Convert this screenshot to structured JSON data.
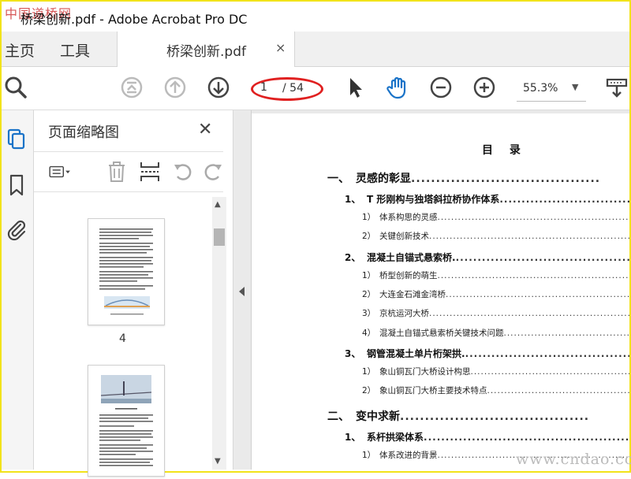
{
  "window": {
    "title": "桥梁创新.pdf - Adobe Acrobat Pro DC",
    "logo_text": "中国道桥网"
  },
  "menu": {
    "home": "主页",
    "tools": "工具"
  },
  "tab": {
    "name": "桥梁创新.pdf",
    "close": "×"
  },
  "toolbar": {
    "page_current": "1",
    "page_total": "/ 54",
    "zoom": "55.3%",
    "zoom_arrow": "▼"
  },
  "thumbnails": {
    "title": "页面缩略图",
    "close": "✕",
    "pages": [
      {
        "label": "4"
      }
    ]
  },
  "toc": {
    "title": "目 录",
    "rows": [
      {
        "level": 1,
        "num": "一、",
        "text": "灵感的彰显",
        "dots": "......................................"
      },
      {
        "level": 2,
        "num": "1、",
        "text": "T 形刚构与独塔斜拉桥协作体系",
        "dots": "............................................"
      },
      {
        "level": 3,
        "num": "1）",
        "text": "体系构思的灵感",
        "dots": "....................................................................................................."
      },
      {
        "level": 3,
        "num": "2）",
        "text": "关键创新技术",
        "dots": "....................................................................................................."
      },
      {
        "level": 2,
        "num": "2、",
        "text": "混凝土自锚式悬索桥.",
        "dots": "...................................................................."
      },
      {
        "level": 3,
        "num": "1）",
        "text": "桥型创新的萌生",
        "dots": "....................................................................................................."
      },
      {
        "level": 3,
        "num": "2）",
        "text": "大连金石滩金湾桥",
        "dots": "....................................................................................................."
      },
      {
        "level": 3,
        "num": "3）",
        "text": "京杭运河大桥",
        "dots": "....................................................................................................."
      },
      {
        "level": 3,
        "num": "4）",
        "text": "混凝土自锚式悬索桥关键技术问题",
        "dots": "....................................................................................................."
      },
      {
        "level": 2,
        "num": "3、",
        "text": "钢管混凝土单片桁架拱.",
        "dots": "..............................................................."
      },
      {
        "level": 3,
        "num": "1）",
        "text": "象山铜瓦门大桥设计构思",
        "dots": "....................................................................................................."
      },
      {
        "level": 3,
        "num": "2）",
        "text": "象山铜瓦门大桥主要技术特点",
        "dots": "....................................................................................................."
      },
      {
        "level": 1,
        "num": "二、",
        "text": "变中求新",
        "dots": "......................................"
      },
      {
        "level": 2,
        "num": "1、",
        "text": "系杆拱梁体系",
        "dots": ".............................................................................."
      },
      {
        "level": 3,
        "num": "1）",
        "text": "体系改进的背景",
        "dots": "....................................................................................................."
      }
    ]
  },
  "watermark": {
    "url": "www.cndao.com"
  }
}
